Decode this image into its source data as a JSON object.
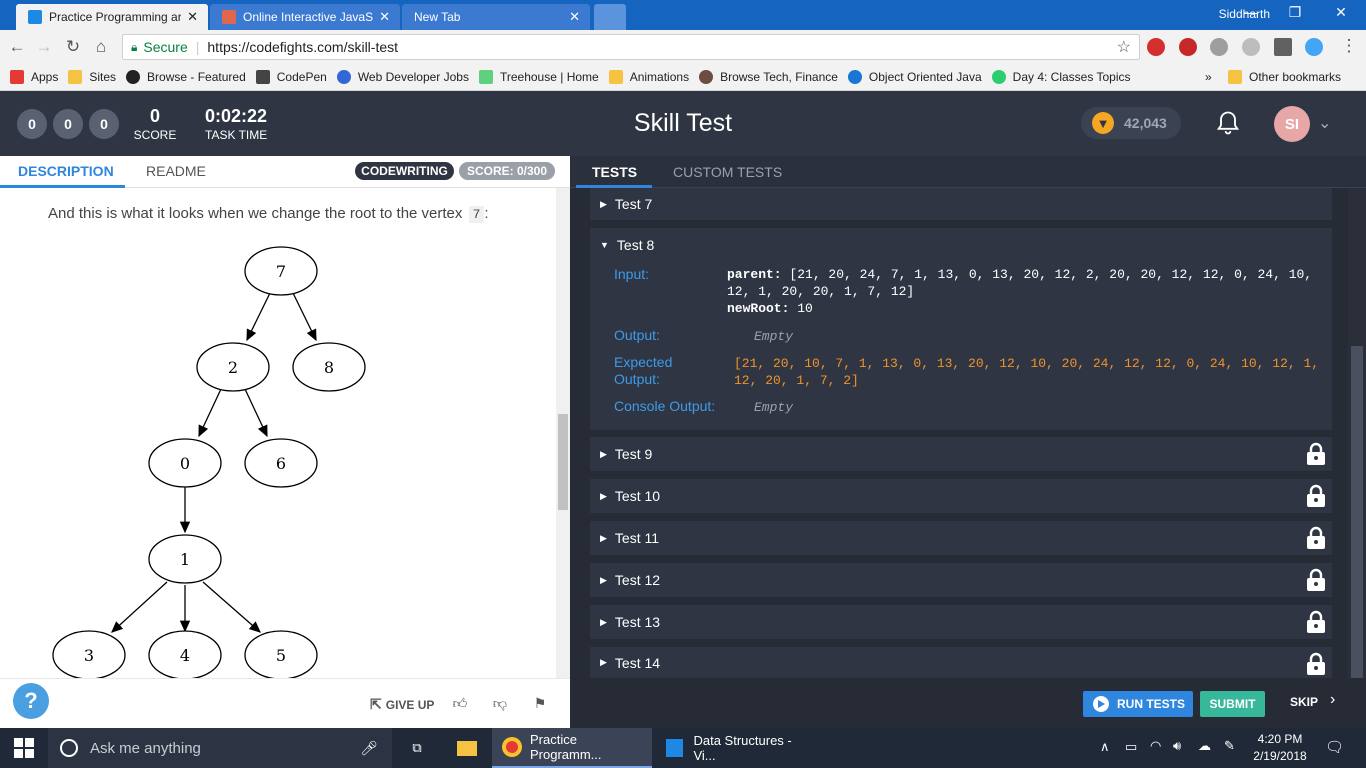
{
  "browser": {
    "tabs": [
      {
        "title": "Practice Programming ar",
        "active": true
      },
      {
        "title": "Online Interactive JavaSc",
        "active": false
      },
      {
        "title": "New Tab",
        "active": false
      }
    ],
    "user": "Siddharth",
    "url_secure": "Secure",
    "url": "https://codefights.com/skill-test",
    "bookmarks": [
      "Apps",
      "Sites",
      "Browse - Featured",
      "CodePen",
      "Web Developer Jobs",
      "Treehouse | Home",
      "Animations",
      "Browse Tech, Finance",
      "Object Oriented Java",
      "Day 4: Classes Topics"
    ],
    "bookmarks_more": "»",
    "other_bookmarks": "Other bookmarks"
  },
  "header": {
    "circles": [
      "0",
      "0",
      "0"
    ],
    "score_value": "0",
    "score_label": "SCORE",
    "time_value": "0:02:22",
    "time_label": "TASK TIME",
    "title": "Skill Test",
    "coins": "42,043",
    "avatar": "SI"
  },
  "left": {
    "tabs": [
      "DESCRIPTION",
      "README"
    ],
    "badge_codewriting": "CODEWRITING",
    "badge_score": "SCORE: 0/300",
    "description": "And this is what it looks when we change the root to the vertex",
    "description_code": "7",
    "description_end": ":",
    "tree_nodes": [
      "7",
      "2",
      "8",
      "0",
      "6",
      "1",
      "3",
      "4",
      "5"
    ],
    "give_up": "GIVE UP",
    "help": "?"
  },
  "right": {
    "tabs": [
      "TESTS",
      "CUSTOM TESTS"
    ],
    "test7": "Test 7",
    "test8": {
      "title": "Test 8",
      "input_label": "Input:",
      "input_parent_key": "parent:",
      "input_parent_line1": "[21, 20, 24, 7, 1, 13, 0, 13, 20, 12, 2, 20, 20, 12, 12, 0, 24, 10,",
      "input_parent_line2": "12, 1, 20, 20, 1, 7, 12]",
      "input_newroot_key": "newRoot:",
      "input_newroot_val": "10",
      "output_label": "Output:",
      "output_value": "Empty",
      "expected_label_1": "Expected",
      "expected_label_2": "Output:",
      "expected_line1": "[21, 20, 10, 7, 1, 13, 0, 13, 20, 12, 10, 20, 24, 12, 12, 0, 24, 10, 12, 1,",
      "expected_line2": "12, 20, 1, 7, 2]",
      "console_label": "Console Output:",
      "console_value": "Empty"
    },
    "locked_tests": [
      "Test 9",
      "Test 10",
      "Test 11",
      "Test 12",
      "Test 13",
      "Test 14"
    ],
    "run_tests": "RUN TESTS",
    "submit": "SUBMIT",
    "skip": "SKIP"
  },
  "taskbar": {
    "search_placeholder": "Ask me anything",
    "apps": [
      "Practice Programm...",
      "Data Structures - Vi..."
    ],
    "time": "4:20 PM",
    "date": "2/19/2018"
  },
  "colors": {
    "accent": "#2e86de",
    "submit": "#38b89a",
    "expected_orange": "#f0932b",
    "app_header": "#2f3542"
  }
}
